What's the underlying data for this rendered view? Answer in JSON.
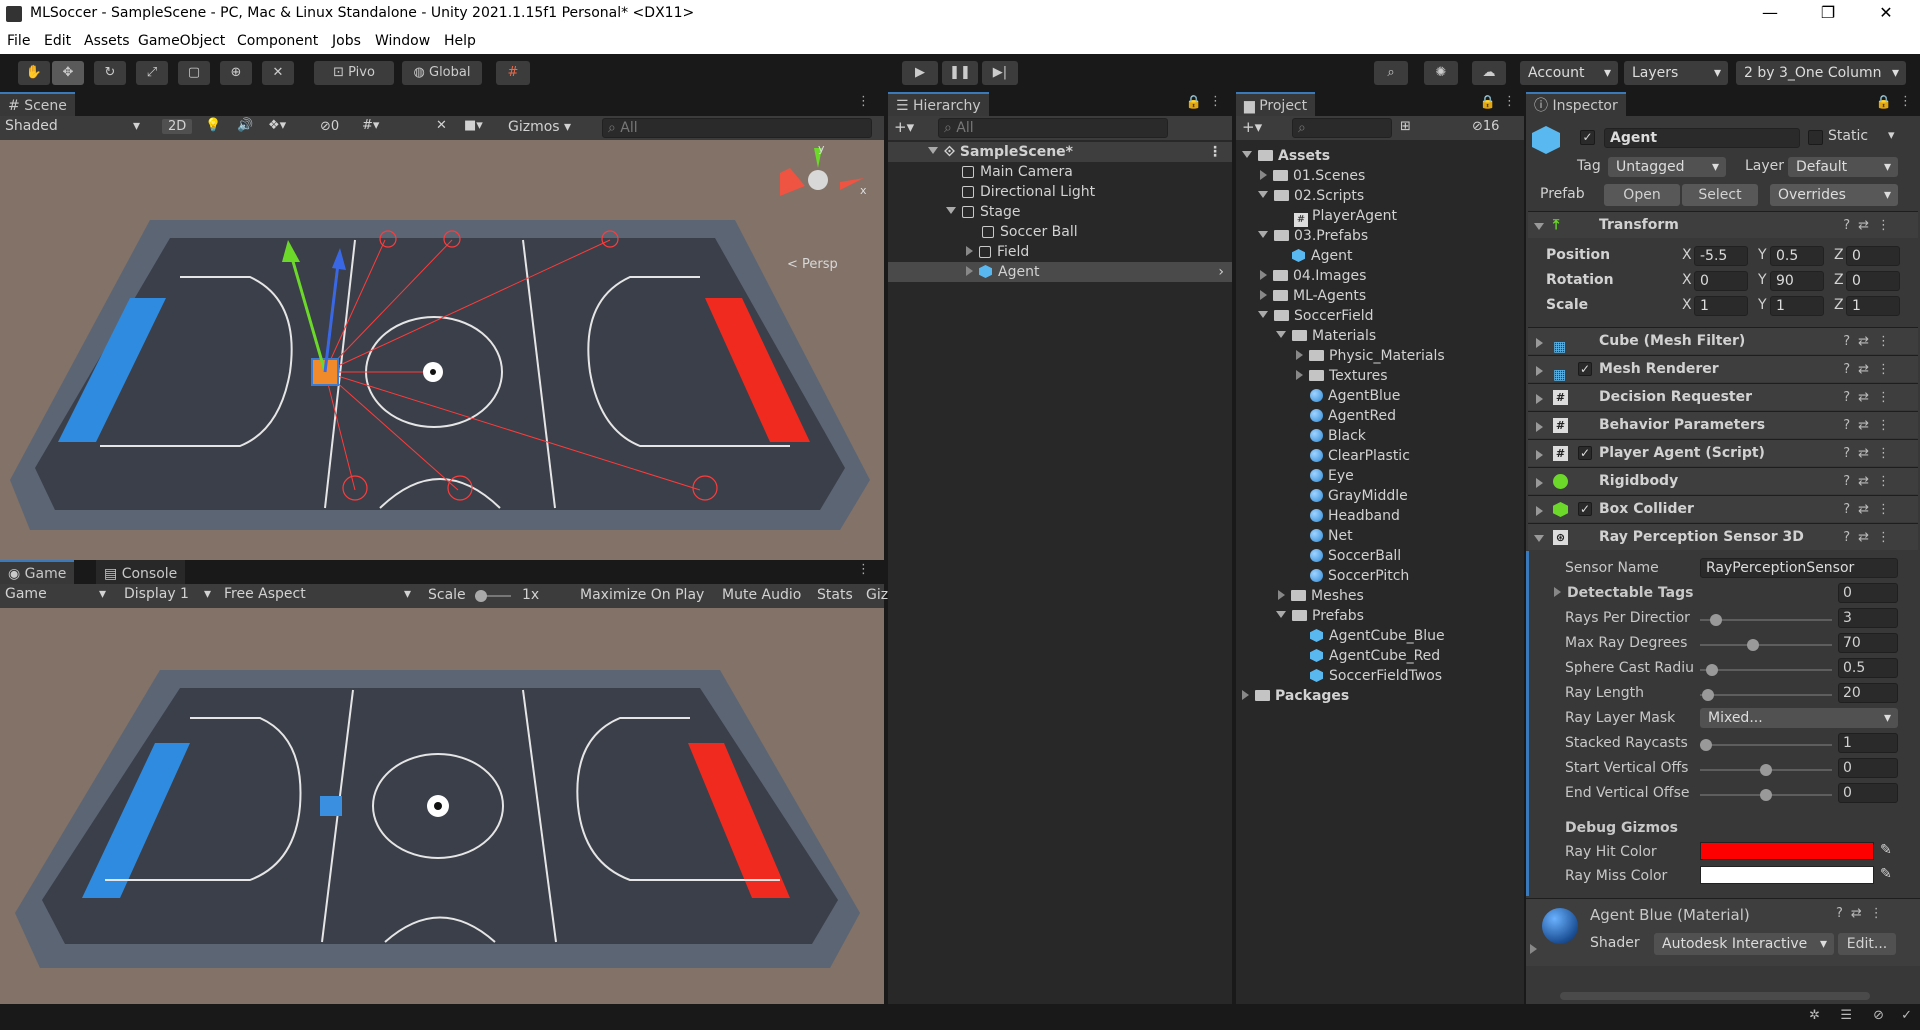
{
  "window": {
    "title": "MLSoccer - SampleScene - PC, Mac & Linux Standalone - Unity 2021.1.15f1 Personal* <DX11>",
    "controls": [
      "—",
      "❐",
      "✕"
    ]
  },
  "menu": [
    "File",
    "Edit",
    "Assets",
    "GameObject",
    "Component",
    "Jobs",
    "Window",
    "Help"
  ],
  "toolbar": {
    "pivot_label": "Pivo",
    "global_label": "Global",
    "account_label": "Account",
    "layers_label": "Layers",
    "layout_label": "2 by 3_One Column"
  },
  "scene": {
    "tab": "Scene",
    "shading": "Shaded",
    "mode_2d": "2D",
    "hidden_count": "0",
    "gizmos": "Gizmos",
    "search_placeholder": "All",
    "persp": "< Persp"
  },
  "game": {
    "tab_game": "Game",
    "tab_console": "Console",
    "display_mode": "Game",
    "display": "Display 1",
    "aspect": "Free Aspect",
    "scale_label": "Scale",
    "scale_value": "1x",
    "maximize": "Maximize On Play",
    "mute": "Mute Audio",
    "stats": "Stats",
    "gizmos": "Giz"
  },
  "hierarchy": {
    "tab": "Hierarchy",
    "search_placeholder": "All",
    "items": [
      "SampleScene*",
      "Main Camera",
      "Directional Light",
      "Stage",
      "Soccer Ball",
      "Field",
      "Agent"
    ]
  },
  "project": {
    "tab": "Project",
    "hidden_count": "16",
    "items": [
      "Assets",
      "01.Scenes",
      "02.Scripts",
      "PlayerAgent",
      "03.Prefabs",
      "Agent",
      "04.Images",
      "ML-Agents",
      "SoccerField",
      "Materials",
      "Physic_Materials",
      "Textures",
      "AgentBlue",
      "AgentRed",
      "Black",
      "ClearPlastic",
      "Eye",
      "GrayMiddle",
      "Headband",
      "Net",
      "SoccerBall",
      "SoccerPitch",
      "Meshes",
      "Prefabs",
      "AgentCube_Blue",
      "AgentCube_Red",
      "SoccerFieldTwos",
      "Packages"
    ]
  },
  "inspector": {
    "tab": "Inspector",
    "object_name": "Agent",
    "static_label": "Static",
    "tag_label": "Tag",
    "tag_value": "Untagged",
    "layer_label": "Layer",
    "layer_value": "Default",
    "prefab_label": "Prefab",
    "open": "Open",
    "select": "Select",
    "overrides": "Overrides",
    "transform": {
      "title": "Transform",
      "position_label": "Position",
      "position": [
        "-5.5",
        "0.5",
        "0"
      ],
      "rotation_label": "Rotation",
      "rotation": [
        "0",
        "90",
        "0"
      ],
      "scale_label": "Scale",
      "scale": [
        "1",
        "1",
        "1"
      ],
      "axes": [
        "X",
        "Y",
        "Z"
      ]
    },
    "components": [
      "Cube (Mesh Filter)",
      "Mesh Renderer",
      "Decision Requester",
      "Behavior Parameters",
      "Player Agent (Script)",
      "Rigidbody",
      "Box Collider",
      "Ray Perception Sensor 3D"
    ],
    "ray": {
      "sensor_name_label": "Sensor Name",
      "sensor_name": "RayPerceptionSensor",
      "detectable_tags_label": "Detectable Tags",
      "detectable_tags": "0",
      "rays_label": "Rays Per Directior",
      "rays": "3",
      "rays_level": 0.08,
      "max_deg_label": "Max Ray Degrees",
      "max_deg": "70",
      "max_deg_level": 0.39,
      "sphere_label": "Sphere Cast Radiu",
      "sphere": "0.5",
      "sphere_level": 0.05,
      "length_label": "Ray Length",
      "length": "20",
      "length_level": 0.02,
      "mask_label": "Ray Layer Mask",
      "mask": "Mixed...",
      "stacked_label": "Stacked Raycasts",
      "stacked": "1",
      "stacked_level": 0.0,
      "start_label": "Start Vertical Offs",
      "start": "0",
      "start_level": 0.5,
      "end_label": "End Vertical Offse",
      "end": "0",
      "end_level": 0.5,
      "debug_label": "Debug Gizmos",
      "hit_label": "Ray Hit Color",
      "hit_color": "#ff0000",
      "miss_label": "Ray Miss Color",
      "miss_color": "#ffffff"
    },
    "material": {
      "name": "Agent Blue (Material)",
      "shader_label": "Shader",
      "shader": "Autodesk Interactive",
      "edit": "Edit..."
    }
  },
  "colors": {
    "accent": "#3a79bb",
    "blue_goal": "#2f8be0",
    "red_goal": "#f02a1e"
  }
}
